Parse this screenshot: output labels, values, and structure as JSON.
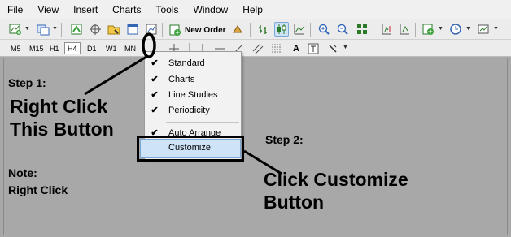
{
  "menubar": {
    "items": [
      "File",
      "View",
      "Insert",
      "Charts",
      "Tools",
      "Window",
      "Help"
    ]
  },
  "toolbar": {
    "new_order_label": "New Order"
  },
  "timeframes": [
    "M5",
    "M15",
    "H1",
    "H4",
    "D1",
    "W1",
    "MN"
  ],
  "context_menu": {
    "items": [
      {
        "label": "Standard",
        "checked": true
      },
      {
        "label": "Charts",
        "checked": true
      },
      {
        "label": "Line Studies",
        "checked": true
      },
      {
        "label": "Periodicity",
        "checked": true
      },
      {
        "label": "Auto Arrange",
        "checked": true
      },
      {
        "label": "Customize",
        "checked": false,
        "highlighted": true
      }
    ]
  },
  "annotations": {
    "step1_title": "Step 1:",
    "step1_line1": "Right Click",
    "step1_line2": "This Button",
    "note_title": "Note:",
    "note_body": "Right Click",
    "step2_title": "Step 2:",
    "step2_line1": "Click Customize",
    "step2_line2": "Button"
  },
  "colors": {
    "chart_background": "#a8a8a8",
    "menu_background": "#f2f2f2",
    "highlight_fill": "#cfe3f7",
    "highlight_border": "#7aa7d6"
  }
}
